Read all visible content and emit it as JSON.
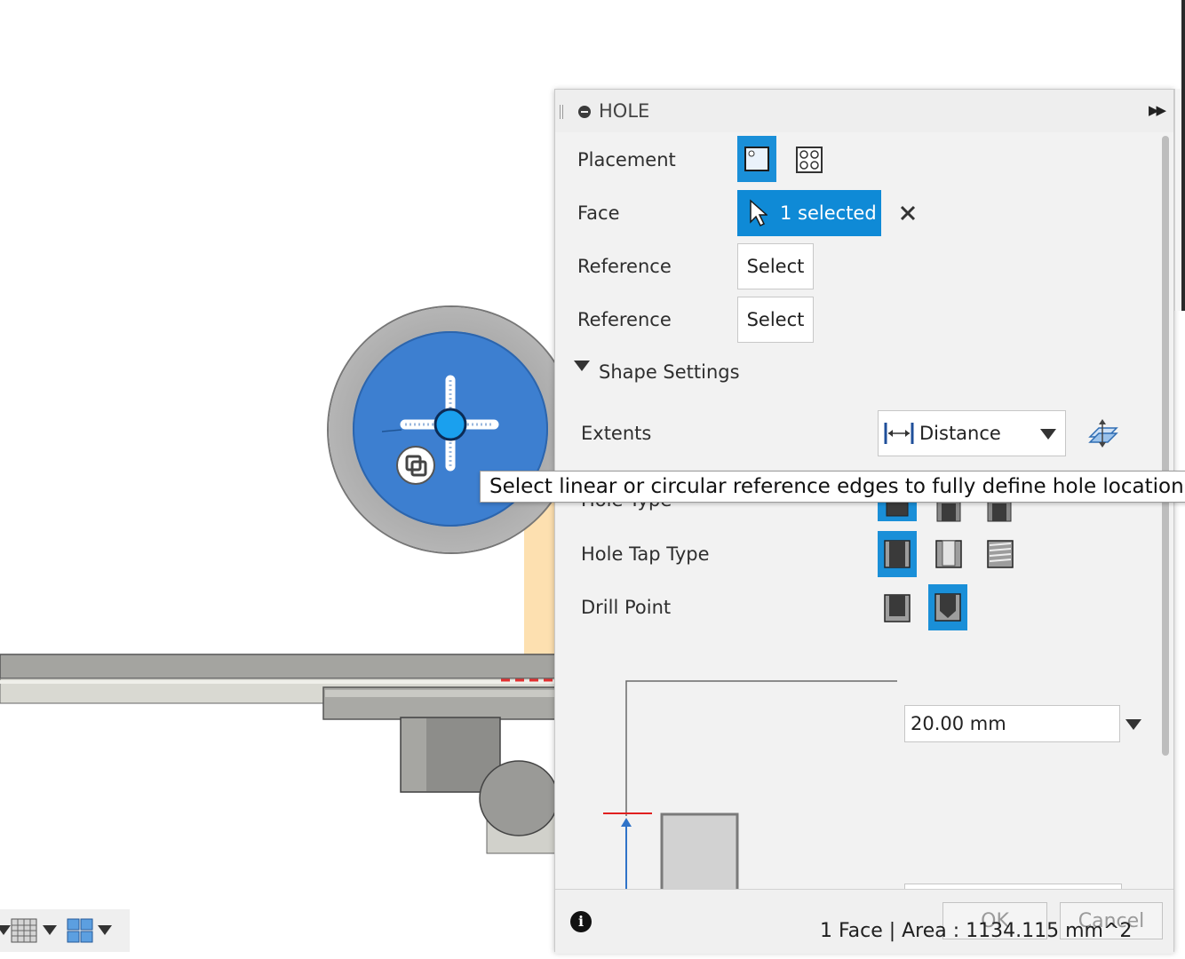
{
  "panel": {
    "title": "HOLE",
    "rows": {
      "placement": "Placement",
      "face": "Face",
      "reference_1": "Reference",
      "reference_2": "Reference",
      "shape_settings": "Shape Settings",
      "extents": "Extents",
      "hole_type": "Hole Type",
      "hole_tap_type": "Hole Tap Type",
      "drill_point": "Drill Point"
    },
    "face_selection": "1 selected",
    "reference_1_button": "Select",
    "reference_2_button": "Select",
    "extents_value": "Distance",
    "depth_value": "20.00 mm",
    "ok_label": "OK",
    "cancel_label": "Cancel",
    "status": "1 Face | Area : 1134.115 mm^2"
  },
  "tooltip": "Select linear or circular reference edges to fully define hole location",
  "colors": {
    "accent": "#1a8fd8",
    "marking_menu": "#3d7fd0",
    "face_highlight": "#fde0b0"
  },
  "icons": [
    "drag-grip-icon",
    "hole-feature-icon",
    "expand-panel-icon",
    "single-hole-icon",
    "multiple-holes-icon",
    "cursor-arrow-icon",
    "clear-selection-icon",
    "distance-icon",
    "flip-direction-icon",
    "simple-hole-icon",
    "counterbore-icon",
    "countersink-icon",
    "simple-tap-icon",
    "clearance-tap-icon",
    "tapped-icon",
    "flat-drill-point-icon",
    "angled-drill-point-icon",
    "info-icon",
    "grid-display-icon",
    "viewports-icon",
    "drag-icon"
  ]
}
